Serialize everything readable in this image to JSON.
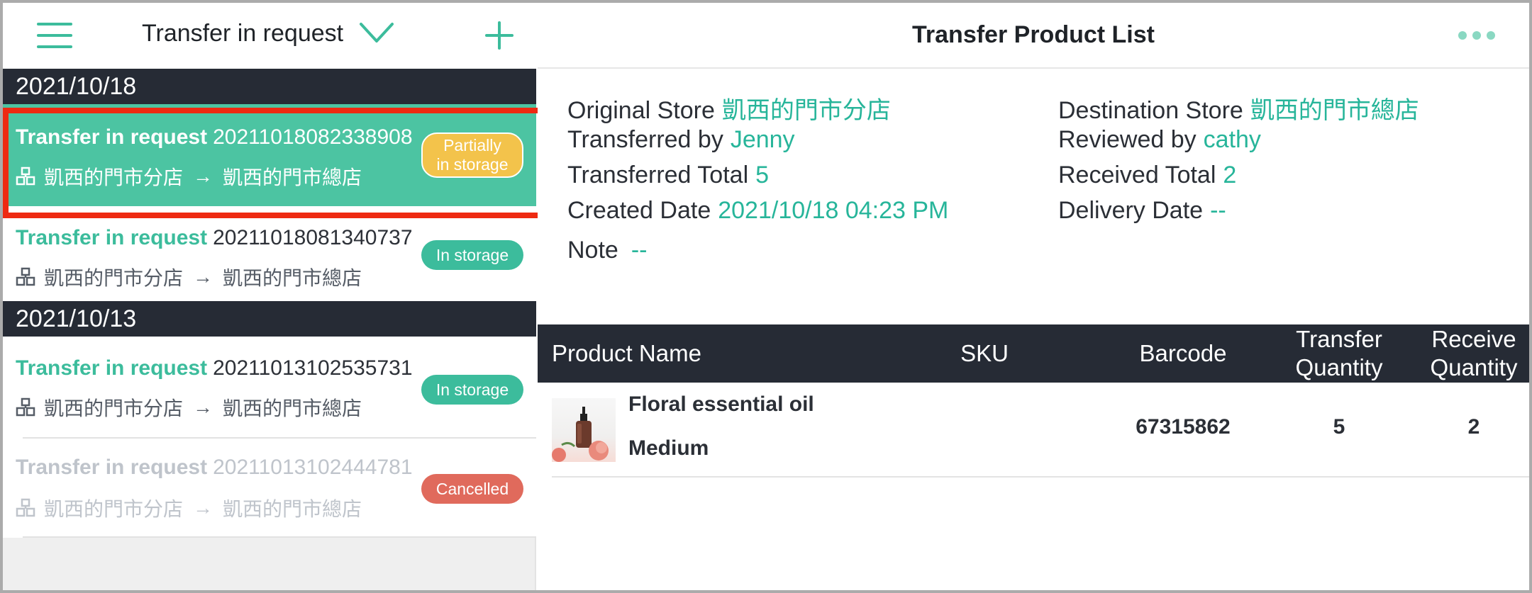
{
  "left": {
    "header_title": "Transfer in request",
    "groups": [
      {
        "date": "2021/10/18",
        "items": [
          {
            "type": "Transfer in request",
            "number": "20211018082338908",
            "from": "凱西的門市分店",
            "arrow": "→",
            "to": "凱西的門市總店",
            "status": "Partially in storage",
            "status_line1": "Partially",
            "status_line2": "in storage",
            "status_color": "#f3c34b",
            "selected": true
          },
          {
            "type": "Transfer in request",
            "number": "20211018081340737",
            "from": "凱西的門市分店",
            "arrow": "→",
            "to": "凱西的門市總店",
            "status": "In storage",
            "status_color": "#3cbc9c"
          }
        ]
      },
      {
        "date": "2021/10/13",
        "items": [
          {
            "type": "Transfer in request",
            "number": "20211013102535731",
            "from": "凱西的門市分店",
            "arrow": "→",
            "to": "凱西的門市總店",
            "status": "In storage",
            "status_color": "#3cbc9c"
          },
          {
            "type": "Transfer in request",
            "number": "20211013102444781",
            "from": "凱西的門市分店",
            "arrow": "→",
            "to": "凱西的門市總店",
            "status": "Cancelled",
            "status_color": "#e06a5c",
            "cancelled": true
          }
        ]
      }
    ]
  },
  "right": {
    "title": "Transfer Product List",
    "info": {
      "original_store_label": "Original Store",
      "original_store": "凱西的門市分店",
      "destination_store_label": "Destination Store",
      "destination_store": "凱西的門市總店",
      "transferred_by_label": "Transferred by",
      "transferred_by": "Jenny",
      "reviewed_by_label": "Reviewed by",
      "reviewed_by": "cathy",
      "transferred_total_label": "Transferred Total",
      "transferred_total": "5",
      "received_total_label": "Received Total",
      "received_total": "2",
      "created_date_label": "Created Date",
      "created_date": "2021/10/18 04:23 PM",
      "delivery_date_label": "Delivery Date",
      "delivery_date": "--",
      "note_label": "Note",
      "note": "--"
    },
    "table": {
      "headers": {
        "product_name": "Product Name",
        "sku": "SKU",
        "barcode": "Barcode",
        "transfer_quantity_l1": "Transfer",
        "transfer_quantity_l2": "Quantity",
        "receive_quantity_l1": "Receive",
        "receive_quantity_l2": "Quantity"
      },
      "rows": [
        {
          "name": "Floral essential oil",
          "variant": "Medium",
          "sku": "",
          "barcode": "67315862",
          "transfer_quantity": "5",
          "receive_quantity": "2"
        }
      ]
    }
  },
  "colors": {
    "accent": "#3cbc9c",
    "dark_bar": "#262b35",
    "highlight": "#ee2a12",
    "cancelled": "#e06a5c",
    "partial": "#f3c34b"
  }
}
